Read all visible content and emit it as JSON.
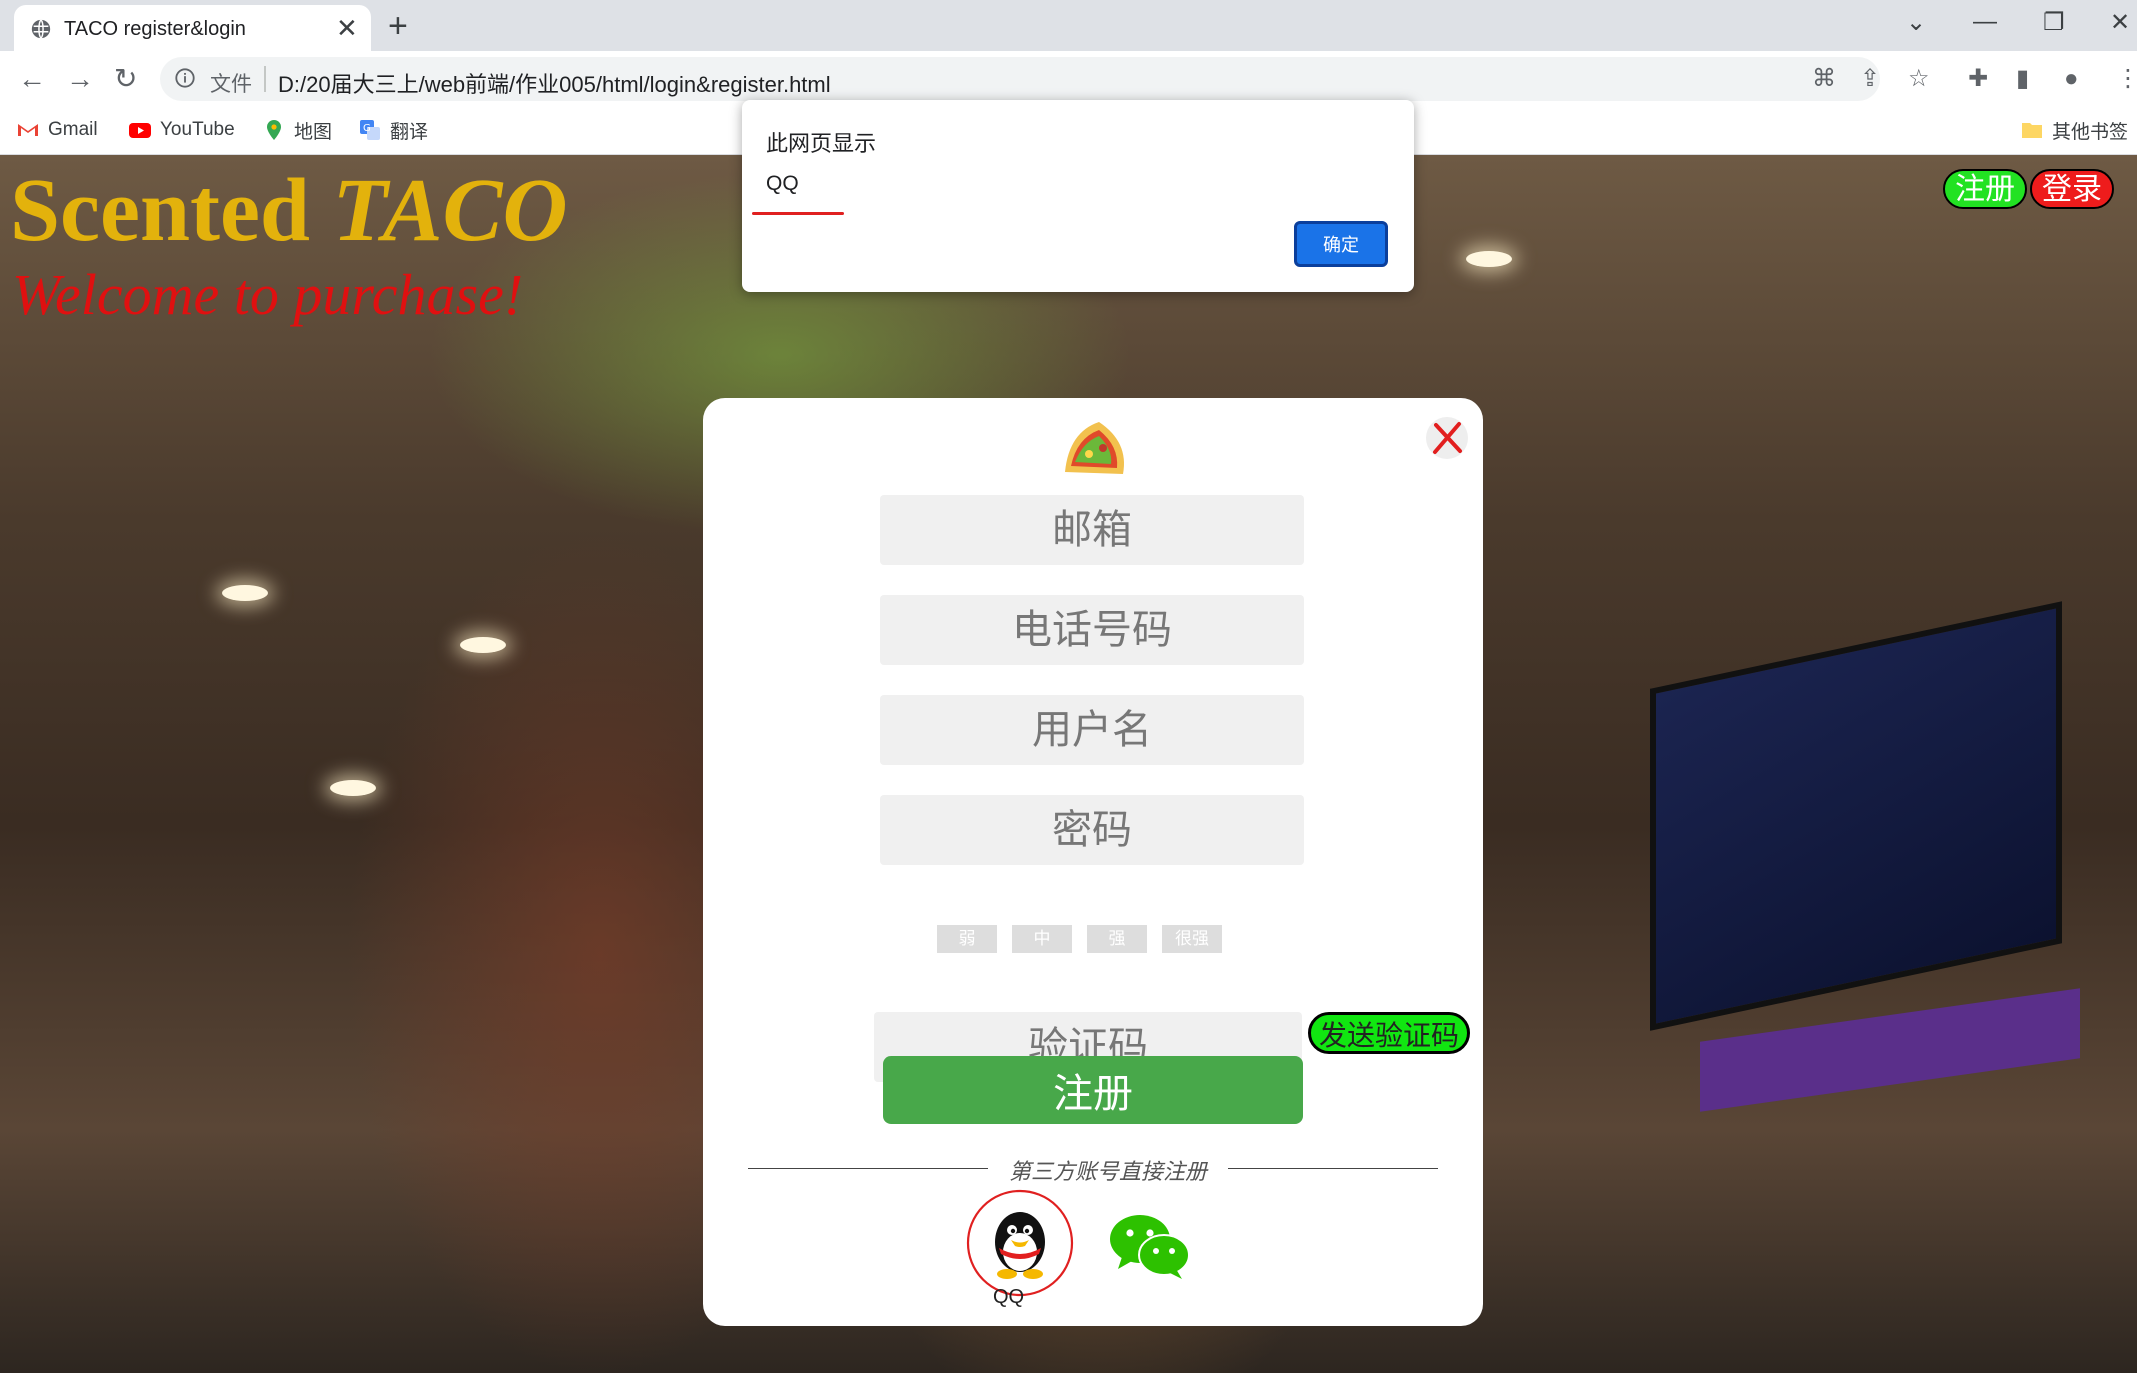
{
  "browser": {
    "tab_title": "TACO register&login",
    "address_scheme": "文件",
    "url": "D:/20届大三上/web前端/作业005/html/login&register.html",
    "bookmarks": [
      {
        "label": "Gmail",
        "icon": "gmail-icon"
      },
      {
        "label": "YouTube",
        "icon": "youtube-icon"
      },
      {
        "label": "地图",
        "icon": "maps-icon"
      },
      {
        "label": "翻译",
        "icon": "translate-icon"
      }
    ],
    "other_bookmarks": "其他书签"
  },
  "header": {
    "title_plain": "Scented ",
    "title_italic": "TACO",
    "subtitle": "Welcome to purchase!",
    "register_btn": "注册",
    "login_btn": "登录"
  },
  "form": {
    "email_placeholder": "邮箱",
    "phone_placeholder": "电话号码",
    "username_placeholder": "用户名",
    "password_placeholder": "密码",
    "strength_levels": [
      "弱",
      "中",
      "强",
      "很强"
    ],
    "code_placeholder": "验证码",
    "send_code": "发送验证码",
    "submit": "注册",
    "third_party_text": "第三方账号直接注册",
    "qq_label": "QQ"
  },
  "alert": {
    "title": "此网页显示",
    "message": "QQ",
    "ok": "确定"
  },
  "colors": {
    "title_gold": "#e3b20c",
    "subtitle_red": "#e01010",
    "submit_green": "#48a84a",
    "send_code_green": "#11e611",
    "alert_button_blue": "#1a73e8"
  }
}
